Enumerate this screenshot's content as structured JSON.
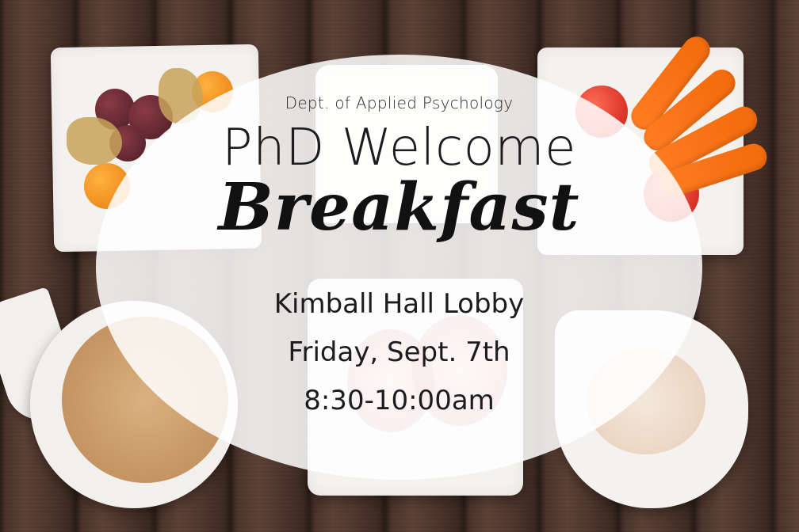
{
  "poster": {
    "department": "Dept. of Applied Psychology",
    "title_line_1": "PhD Welcome",
    "title_line_2": "Breakfast",
    "location": "Kimball Hall Lobby",
    "date": "Friday, Sept. 7th",
    "time": "8:30-10:00am"
  },
  "colors": {
    "background_wood": "#4a342b",
    "overlay": "#ffffff",
    "text": "#1c1c1c"
  }
}
